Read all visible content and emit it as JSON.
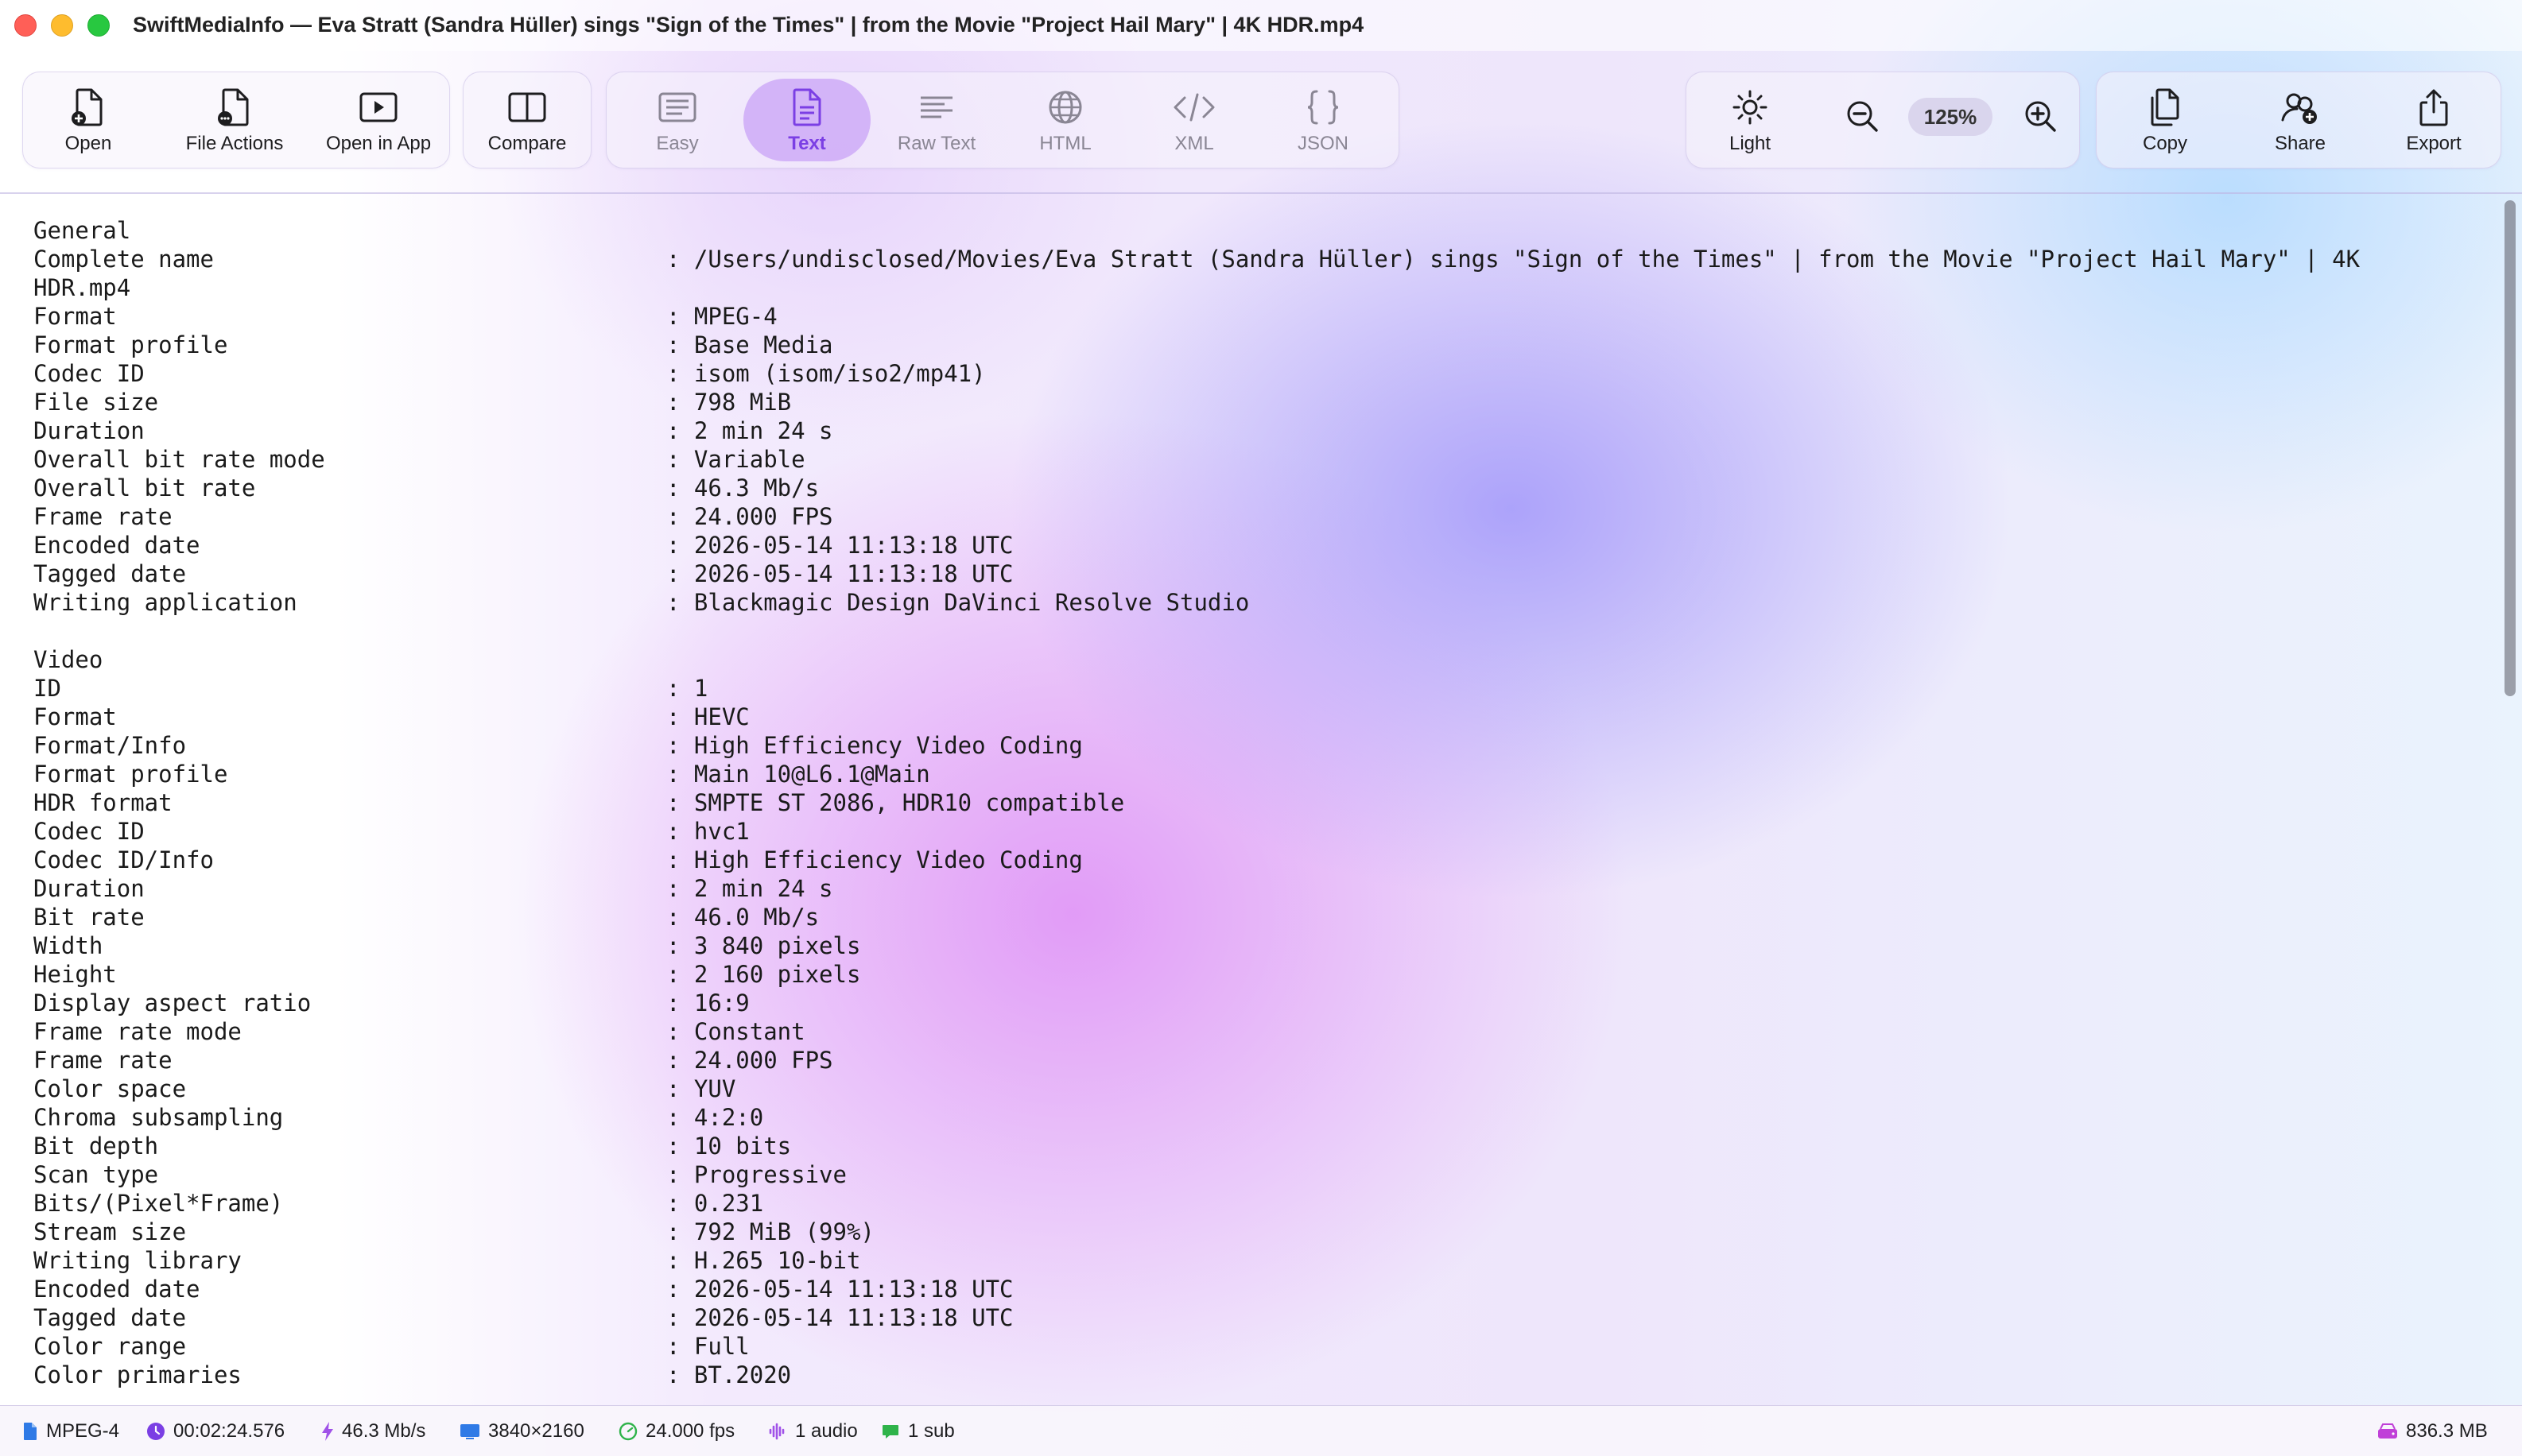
{
  "window": {
    "title": "SwiftMediaInfo — Eva Stratt (Sandra Hüller) sings \"Sign of the Times\" | from the Movie \"Project Hail Mary\" | 4K HDR.mp4"
  },
  "toolbar": {
    "open": "Open",
    "file_actions": "File Actions",
    "open_in_app": "Open in App",
    "compare": "Compare",
    "views": [
      "Easy",
      "Text",
      "Raw Text",
      "HTML",
      "XML",
      "JSON"
    ],
    "active_view": "Text",
    "theme": "Light",
    "zoom": "125%",
    "copy": "Copy",
    "share": "Share",
    "export": "Export"
  },
  "content": {
    "lines": [
      {
        "k": "General",
        "v": ""
      },
      {
        "k": "Complete name",
        "v": ": /Users/undisclosed/Movies/Eva Stratt (Sandra Hüller) sings \"Sign of the Times\" | from the Movie \"Project Hail Mary\" | 4K"
      },
      {
        "k": "HDR.mp4",
        "v": ""
      },
      {
        "k": "Format",
        "v": ": MPEG-4"
      },
      {
        "k": "Format profile",
        "v": ": Base Media"
      },
      {
        "k": "Codec ID",
        "v": ": isom (isom/iso2/mp41)"
      },
      {
        "k": "File size",
        "v": ": 798 MiB"
      },
      {
        "k": "Duration",
        "v": ": 2 min 24 s"
      },
      {
        "k": "Overall bit rate mode",
        "v": ": Variable"
      },
      {
        "k": "Overall bit rate",
        "v": ": 46.3 Mb/s"
      },
      {
        "k": "Frame rate",
        "v": ": 24.000 FPS"
      },
      {
        "k": "Encoded date",
        "v": ": 2026-05-14 11:13:18 UTC"
      },
      {
        "k": "Tagged date",
        "v": ": 2026-05-14 11:13:18 UTC"
      },
      {
        "k": "Writing application",
        "v": ": Blackmagic Design DaVinci Resolve Studio"
      },
      {
        "k": "",
        "v": ""
      },
      {
        "k": "Video",
        "v": ""
      },
      {
        "k": "ID",
        "v": ": 1"
      },
      {
        "k": "Format",
        "v": ": HEVC"
      },
      {
        "k": "Format/Info",
        "v": ": High Efficiency Video Coding"
      },
      {
        "k": "Format profile",
        "v": ": Main 10@L6.1@Main"
      },
      {
        "k": "HDR format",
        "v": ": SMPTE ST 2086, HDR10 compatible"
      },
      {
        "k": "Codec ID",
        "v": ": hvc1"
      },
      {
        "k": "Codec ID/Info",
        "v": ": High Efficiency Video Coding"
      },
      {
        "k": "Duration",
        "v": ": 2 min 24 s"
      },
      {
        "k": "Bit rate",
        "v": ": 46.0 Mb/s"
      },
      {
        "k": "Width",
        "v": ": 3 840 pixels"
      },
      {
        "k": "Height",
        "v": ": 2 160 pixels"
      },
      {
        "k": "Display aspect ratio",
        "v": ": 16:9"
      },
      {
        "k": "Frame rate mode",
        "v": ": Constant"
      },
      {
        "k": "Frame rate",
        "v": ": 24.000 FPS"
      },
      {
        "k": "Color space",
        "v": ": YUV"
      },
      {
        "k": "Chroma subsampling",
        "v": ": 4:2:0"
      },
      {
        "k": "Bit depth",
        "v": ": 10 bits"
      },
      {
        "k": "Scan type",
        "v": ": Progressive"
      },
      {
        "k": "Bits/(Pixel*Frame)",
        "v": ": 0.231"
      },
      {
        "k": "Stream size",
        "v": ": 792 MiB (99%)"
      },
      {
        "k": "Writing library",
        "v": ": H.265 10-bit"
      },
      {
        "k": "Encoded date",
        "v": ": 2026-05-14 11:13:18 UTC"
      },
      {
        "k": "Tagged date",
        "v": ": 2026-05-14 11:13:18 UTC"
      },
      {
        "k": "Color range",
        "v": ": Full"
      },
      {
        "k": "Color primaries",
        "v": ": BT.2020"
      }
    ]
  },
  "statusbar": {
    "format": "MPEG-4",
    "duration": "00:02:24.576",
    "bitrate": "46.3 Mb/s",
    "resolution": "3840×2160",
    "fps": "24.000 fps",
    "audio": "1 audio",
    "subs": "1 sub",
    "size": "836.3 MB"
  },
  "colors": {
    "accent": "#7b3fe4",
    "active_button_bg": "#ceaaf7",
    "traffic_red": "#ff5f57",
    "traffic_yellow": "#febc2e",
    "traffic_green": "#28c840"
  }
}
